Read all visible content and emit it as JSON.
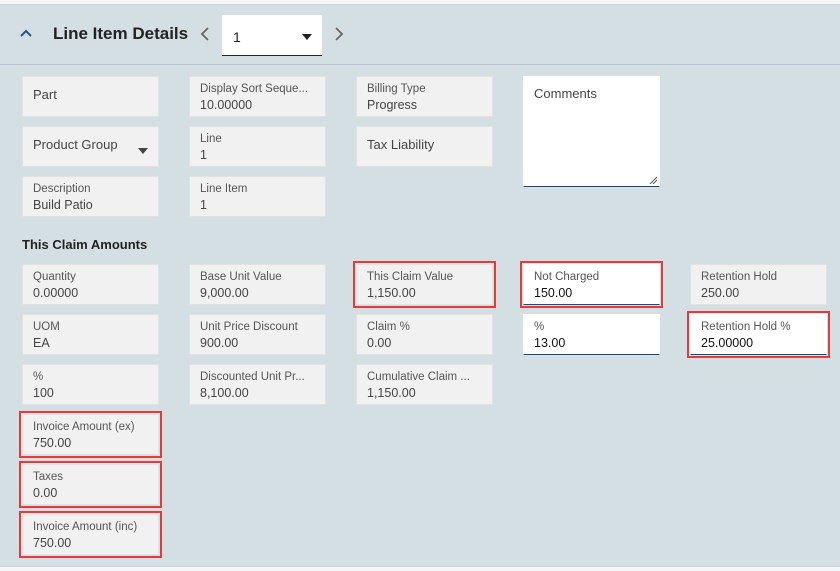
{
  "header": {
    "title": "Line Item Details",
    "pager_value": "1"
  },
  "fields": {
    "part": {
      "label": "Part"
    },
    "product_group": {
      "label": "Product Group"
    },
    "description": {
      "label": "Description",
      "value": "Build Patio"
    },
    "display_sort": {
      "label": "Display Sort Seque...",
      "value": "10.00000"
    },
    "line": {
      "label": "Line",
      "value": "1"
    },
    "line_item": {
      "label": "Line Item",
      "value": "1"
    },
    "billing_type": {
      "label": "Billing Type",
      "value": "Progress"
    },
    "tax_liability": {
      "label": "Tax Liability"
    },
    "comments": {
      "label": "Comments"
    }
  },
  "claim": {
    "section_title": "This Claim Amounts",
    "quantity": {
      "label": "Quantity",
      "value": "0.00000"
    },
    "uom": {
      "label": "UOM",
      "value": "EA"
    },
    "percent1": {
      "label": "%",
      "value": "100"
    },
    "invoice_ex": {
      "label": "Invoice Amount (ex)",
      "value": "750.00"
    },
    "taxes": {
      "label": "Taxes",
      "value": "0.00"
    },
    "invoice_inc": {
      "label": "Invoice Amount (inc)",
      "value": "750.00"
    },
    "base_unit_value": {
      "label": "Base Unit Value",
      "value": "9,000.00"
    },
    "unit_price_discount": {
      "label": "Unit Price Discount",
      "value": "900.00"
    },
    "discounted_unit_price": {
      "label": "Discounted Unit Pr...",
      "value": "8,100.00"
    },
    "this_claim_value": {
      "label": "This Claim Value",
      "value": "1,150.00"
    },
    "claim_percent": {
      "label": "Claim %",
      "value": "0.00"
    },
    "cumulative_claim": {
      "label": "Cumulative Claim ...",
      "value": "1,150.00"
    },
    "not_charged": {
      "label": "Not Charged",
      "value": "150.00"
    },
    "percent2": {
      "label": "%",
      "value": "13.00"
    },
    "retention_hold": {
      "label": "Retention Hold",
      "value": "250.00"
    },
    "retention_hold_pct": {
      "label": "Retention Hold %",
      "value": "25.00000"
    }
  },
  "colors": {
    "background": "#d3dfe3",
    "field_bg": "#f1f1f1",
    "highlight": "#e03c3c",
    "input_underline": "#1a4a78"
  },
  "icons": [
    "chevron-up-icon",
    "chevron-left-icon",
    "chevron-right-icon",
    "caret-down-icon"
  ]
}
